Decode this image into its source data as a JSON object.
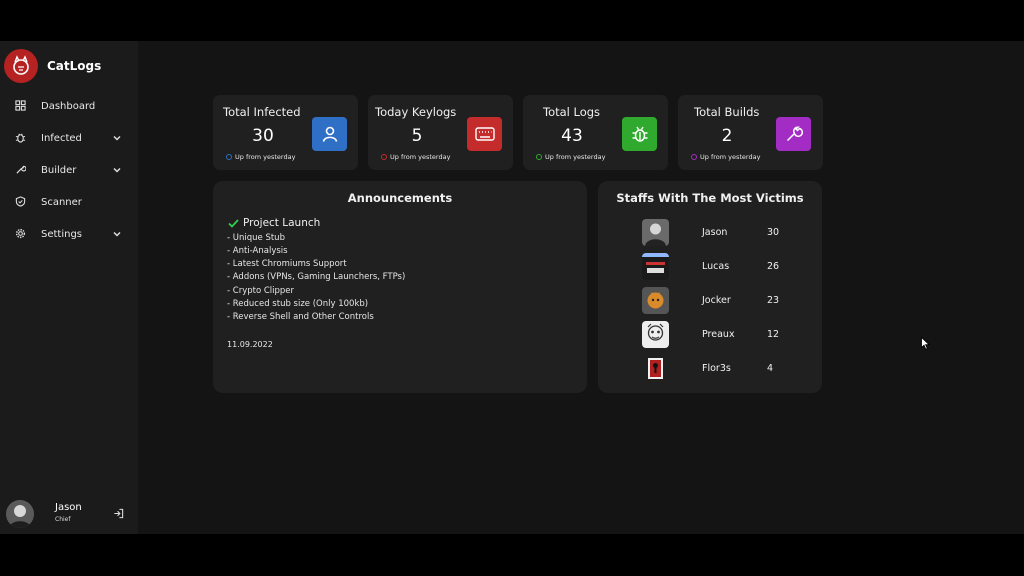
{
  "brand": {
    "name": "CatLogs"
  },
  "nav": [
    {
      "label": "Dashboard",
      "icon": "grid-icon",
      "expandable": false
    },
    {
      "label": "Infected",
      "icon": "bug-icon",
      "expandable": true
    },
    {
      "label": "Builder",
      "icon": "wrench-icon",
      "expandable": true
    },
    {
      "label": "Scanner",
      "icon": "shield-icon",
      "expandable": false
    },
    {
      "label": "Settings",
      "icon": "gear-icon",
      "expandable": true
    }
  ],
  "user": {
    "name": "Jason",
    "role": "Chief"
  },
  "stats": [
    {
      "title": "Total Infected",
      "value": "30",
      "footer": "Up from yesterday",
      "icon": "user-icon",
      "color": "#2f6fc6"
    },
    {
      "title": "Today Keylogs",
      "value": "5",
      "footer": "Up from yesterday",
      "icon": "keyboard-icon",
      "color": "#c42b2b"
    },
    {
      "title": "Total Logs",
      "value": "43",
      "footer": "Up from yesterday",
      "icon": "bug-icon",
      "color": "#2faa2f"
    },
    {
      "title": "Total Builds",
      "value": "2",
      "footer": "Up from yesterday",
      "icon": "wrench-icon",
      "color": "#a32dc4"
    }
  ],
  "announcements": {
    "title": "Announcements",
    "headline": "Project Launch",
    "items": [
      "- Unique Stub",
      "- Anti-Analysis",
      "- Latest Chromiums Support",
      "- Addons (VPNs, Gaming Launchers, FTPs)",
      "- Crypto Clipper",
      "- Reduced stub size (Only 100kb)",
      "- Reverse Shell and Other Controls"
    ],
    "date": "11.09.2022"
  },
  "staff": {
    "title": "Staffs With The Most Victims",
    "rows": [
      {
        "name": "Jason",
        "count": "30"
      },
      {
        "name": "Lucas",
        "count": "26"
      },
      {
        "name": "Jocker",
        "count": "23"
      },
      {
        "name": "Preaux",
        "count": "12"
      },
      {
        "name": "Flor3s",
        "count": "4"
      }
    ]
  }
}
